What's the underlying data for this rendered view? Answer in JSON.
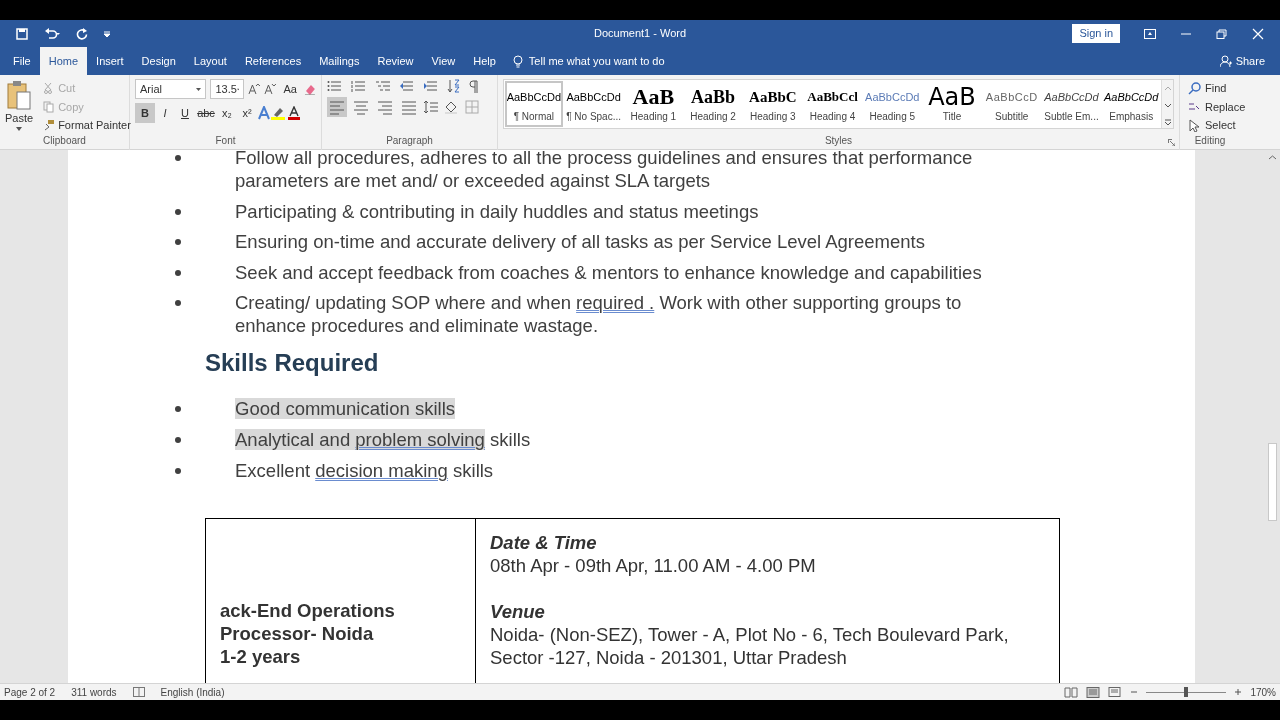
{
  "window": {
    "title": "Document1  -  Word",
    "sign_in": "Sign in"
  },
  "tabs": [
    {
      "label": "File",
      "selected": false
    },
    {
      "label": "Home",
      "selected": true
    },
    {
      "label": "Insert",
      "selected": false
    },
    {
      "label": "Design",
      "selected": false
    },
    {
      "label": "Layout",
      "selected": false
    },
    {
      "label": "References",
      "selected": false
    },
    {
      "label": "Mailings",
      "selected": false
    },
    {
      "label": "Review",
      "selected": false
    },
    {
      "label": "View",
      "selected": false
    },
    {
      "label": "Help",
      "selected": false
    }
  ],
  "tell_me": {
    "placeholder": "Tell me what you want to do"
  },
  "share": "Share",
  "clipboard": {
    "label": "Clipboard",
    "paste": "Paste",
    "items": [
      {
        "label": "Cut",
        "disabled": true
      },
      {
        "label": "Copy",
        "disabled": true
      },
      {
        "label": "Format Painter",
        "disabled": false
      }
    ]
  },
  "font": {
    "label": "Font",
    "name": "Arial",
    "size": "13.5",
    "change_case": "Aa",
    "format_buttons": [
      {
        "label": "B",
        "selected": true
      },
      {
        "label": "I",
        "selected": false
      },
      {
        "label": "U",
        "selected": false
      },
      {
        "label": "abc",
        "selected": false
      },
      {
        "label": "x₂",
        "selected": false
      },
      {
        "label": "x²",
        "selected": false
      }
    ]
  },
  "paragraph": {
    "label": "Paragraph",
    "align_buttons": [
      {
        "selected": true
      },
      {
        "selected": false
      },
      {
        "selected": false
      },
      {
        "selected": false
      }
    ]
  },
  "styles": {
    "label": "Styles",
    "items": [
      {
        "preview": "AaBbCcDd",
        "name": "¶ Normal",
        "kind": "normal",
        "selected": true
      },
      {
        "preview": "AaBbCcDd",
        "name": "¶ No Spac...",
        "kind": "normal",
        "selected": false
      },
      {
        "preview": "AaB",
        "name": "Heading 1",
        "kind": "h1",
        "selected": false
      },
      {
        "preview": "AaBb",
        "name": "Heading 2",
        "kind": "h2",
        "selected": false
      },
      {
        "preview": "AaBbC",
        "name": "Heading 3",
        "kind": "h3",
        "selected": false
      },
      {
        "preview": "AaBbCcl",
        "name": "Heading 4",
        "kind": "h4",
        "selected": false
      },
      {
        "preview": "AaBbCcDd",
        "name": "Heading 5",
        "kind": "h5",
        "selected": false
      },
      {
        "preview": "AaB",
        "name": "Title",
        "kind": "title",
        "selected": false
      },
      {
        "preview": "AaBbCcD",
        "name": "Subtitle",
        "kind": "subtitle",
        "selected": false
      },
      {
        "preview": "AaBbCcDd",
        "name": "Subtle Em...",
        "kind": "subtle",
        "selected": false
      },
      {
        "preview": "AaBbCcDd",
        "name": "Emphasis",
        "kind": "emphasis",
        "selected": false
      }
    ]
  },
  "editing": {
    "label": "Editing",
    "items": [
      "Find",
      "Replace",
      "Select"
    ]
  },
  "document": {
    "bullets_top": [
      {
        "segments": [
          {
            "text": "Follow all procedures, adheres to all the process guidelines and ensures that performance parameters are met and/ or exceeded against SLA targets",
            "selected": false,
            "underlined": false
          }
        ]
      },
      {
        "segments": [
          {
            "text": "Participating & contributing in daily huddles and status meetings",
            "selected": false,
            "underlined": false
          }
        ]
      },
      {
        "segments": [
          {
            "text": "Ensuring on-time and accurate delivery of all tasks as per Service Level Agreements",
            "selected": false,
            "underlined": false
          }
        ]
      },
      {
        "segments": [
          {
            "text": "Seek and accept feedback from coaches & mentors to enhance knowledge and capabilities",
            "selected": false,
            "underlined": false
          }
        ]
      },
      {
        "segments": [
          {
            "text": "Creating/ updating SOP where and when ",
            "selected": false,
            "underlined": false
          },
          {
            "text": "required .",
            "selected": false,
            "underlined": true
          },
          {
            "text": " Work with other supporting groups to enhance procedures and eliminate wastage.",
            "selected": false,
            "underlined": false
          }
        ]
      }
    ],
    "heading": "Skills Required",
    "bullets_skills": [
      {
        "segments": [
          {
            "text": "Good communication skills",
            "selected": true,
            "underlined": false
          }
        ]
      },
      {
        "segments": [
          {
            "text": "Analytical and ",
            "selected": true,
            "underlined": false
          },
          {
            "text": "problem solving",
            "selected": true,
            "underlined": true
          },
          {
            "text": " skills",
            "selected": false,
            "underlined": false
          }
        ]
      },
      {
        "segments": [
          {
            "text": "Excellent ",
            "selected": false,
            "underlined": false
          },
          {
            "text": "decision making",
            "selected": false,
            "underlined": true
          },
          {
            "text": " skills",
            "selected": false,
            "underlined": false
          }
        ]
      }
    ],
    "table": {
      "left": [
        "ack-End Operations",
        "Processor- Noida",
        "1-2 years"
      ],
      "right": [
        {
          "heading": "Date & Time",
          "lines": [
            "08th Apr - 09th Apr, 11.00 AM - 4.00 PM"
          ]
        },
        {
          "heading": "Venue",
          "lines": [
            "Noida- (Non-SEZ), Tower - A, Plot No - 6, Tech Boulevard Park, Sector -127, Noida - 201301, Uttar Pradesh"
          ]
        }
      ]
    }
  },
  "status_bar": {
    "page": "Page 2 of 2",
    "words": "311 words",
    "language": "English (India)",
    "zoom": "170%",
    "zoom_slider": {
      "level": 0.5
    }
  }
}
